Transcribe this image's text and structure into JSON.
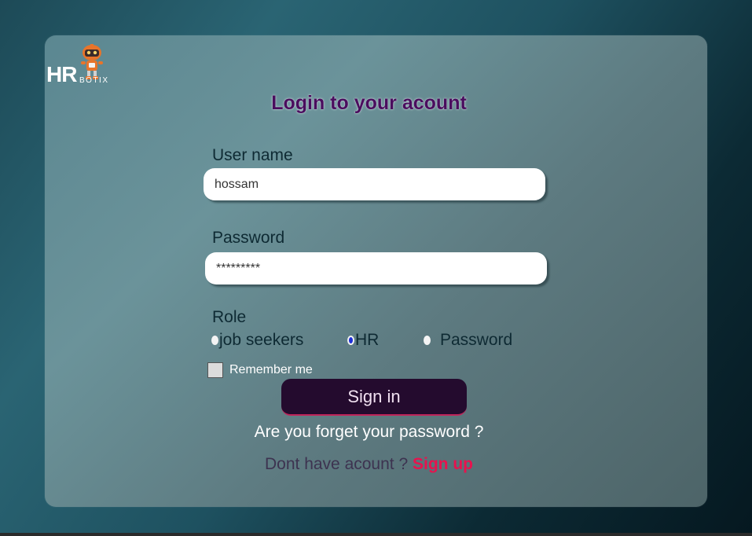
{
  "logo": {
    "hr_text": "HR",
    "botix_text": "BOTIX",
    "robot": "robot-mascot-icon"
  },
  "form": {
    "title": "Login to your acount",
    "username_label": "User name",
    "username_value": "hossam",
    "password_label": "Password",
    "password_value": "*********",
    "role_label": "Role",
    "roles": [
      {
        "label": "job seekers",
        "checked": false
      },
      {
        "label": "HR",
        "checked": true
      },
      {
        "label": "Password",
        "checked": false
      }
    ],
    "remember_label": "Remember me",
    "signin_label": "Sign in",
    "forgot_text": "Are you forget your password ?",
    "no_account_text": "Dont have acount ?",
    "signup_text": "Sign up"
  },
  "colors": {
    "title": "#4a0d5e",
    "signin_bg": "#240b2e",
    "signup_link": "#e8124e",
    "radio_checked": "#1e2fd8"
  }
}
